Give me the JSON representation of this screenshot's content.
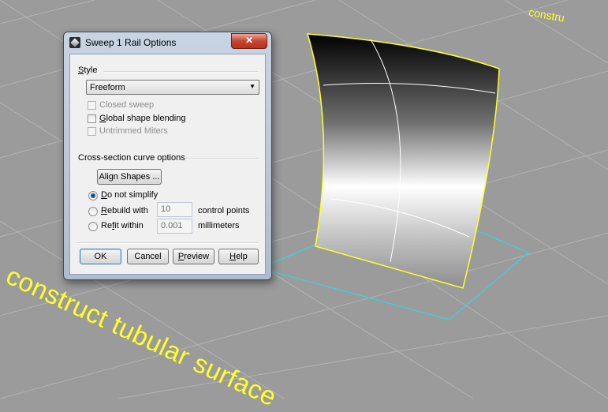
{
  "viewport": {
    "annotation_main": "construct tubular surface",
    "annotation_top": "constru",
    "grid_color": "#b3b3b3",
    "background_color": "#9b9b9b",
    "annotation_color": "#ffff2a"
  },
  "dialog": {
    "title": "Sweep 1 Rail Options",
    "close_glyph": "✕",
    "style_label": "Style",
    "style_value": "Freeform",
    "closed_sweep": {
      "label": "Closed sweep",
      "checked": false,
      "enabled": false
    },
    "global_shape_blending": {
      "label": "Global shape blending",
      "checked": false,
      "enabled": true
    },
    "untrimmed_miters": {
      "label": "Untrimmed Miters",
      "checked": false,
      "enabled": false
    },
    "cross_section_label": "Cross-section curve options",
    "align_shapes_label": "Align Shapes ...",
    "do_not_simplify": {
      "label": "Do not simplify",
      "selected": true
    },
    "rebuild_with": {
      "label": "Rebuild with",
      "value": "10",
      "unit": "control points",
      "selected": false
    },
    "refit_within": {
      "label": "Refit within",
      "value": "0.001",
      "unit": "millimeters",
      "selected": false
    },
    "buttons": {
      "ok": "OK",
      "cancel": "Cancel",
      "preview": "Preview",
      "help": "Help"
    }
  }
}
